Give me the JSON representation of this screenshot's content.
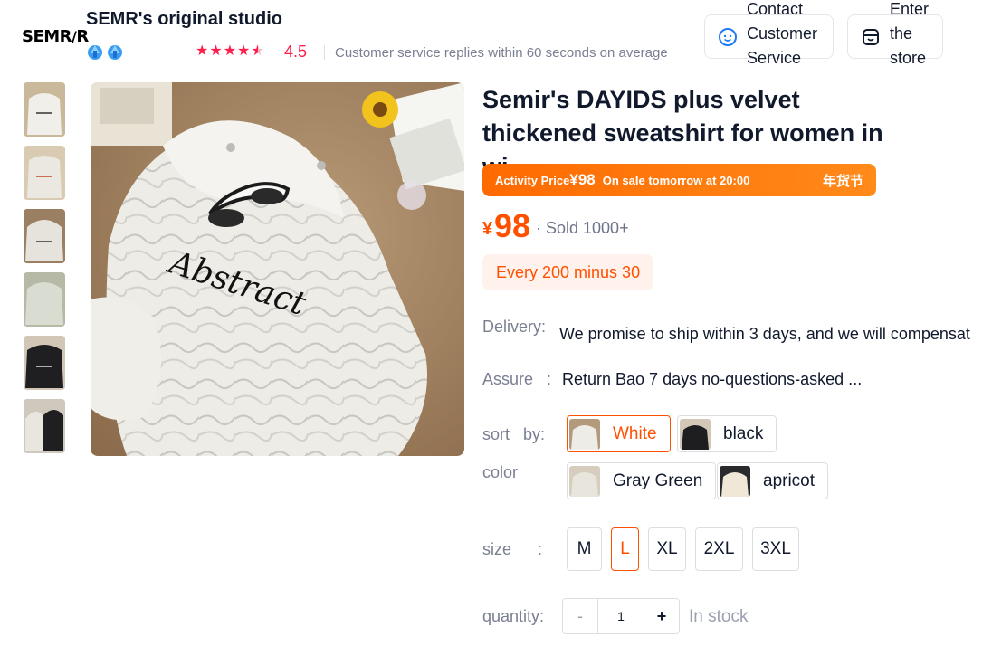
{
  "shop": {
    "logo_text": "SEMR",
    "name": "SEMR's original studio",
    "rating": "4.5",
    "stars_count": 4.5,
    "service_note": "Customer service replies within 60 seconds on average",
    "contact_label": "Contact Customer Service",
    "store_label": "Enter the store"
  },
  "product": {
    "title": "Semir's DAYIDS plus velvet thickened sweatshirt for women in wi...",
    "promo": {
      "label": "Activity Price",
      "price": "¥98",
      "note": "On sale tomorrow at 20:00",
      "tag": "年货节"
    },
    "price_symbol": "¥",
    "price": "98",
    "sold": "· Sold 1000+",
    "coupon": "Every 200 minus 30",
    "delivery_label": "Delivery:",
    "delivery_text": "We promise to ship within 3 days, and we will compensat",
    "assure_label": "Assure :",
    "assure_text": "Return Bao 7 days no-questions-asked ...",
    "sort_label": "sort by:",
    "color_label": "color",
    "colors": [
      {
        "label": "White",
        "selected": true
      },
      {
        "label": "black",
        "selected": false
      },
      {
        "label": "Gray Green",
        "selected": false
      },
      {
        "label": "apricot",
        "selected": false
      }
    ],
    "size_label": "size :",
    "sizes": [
      {
        "label": "M",
        "selected": false
      },
      {
        "label": "L",
        "selected": true
      },
      {
        "label": "XL",
        "selected": false
      },
      {
        "label": "2XL",
        "selected": false
      },
      {
        "label": "3XL",
        "selected": false
      }
    ],
    "quantity_label": "quantity:",
    "quantity": {
      "minus": "-",
      "value": "1",
      "plus": "+"
    },
    "stock": "In stock"
  },
  "image_overlay_text": "Abstract"
}
